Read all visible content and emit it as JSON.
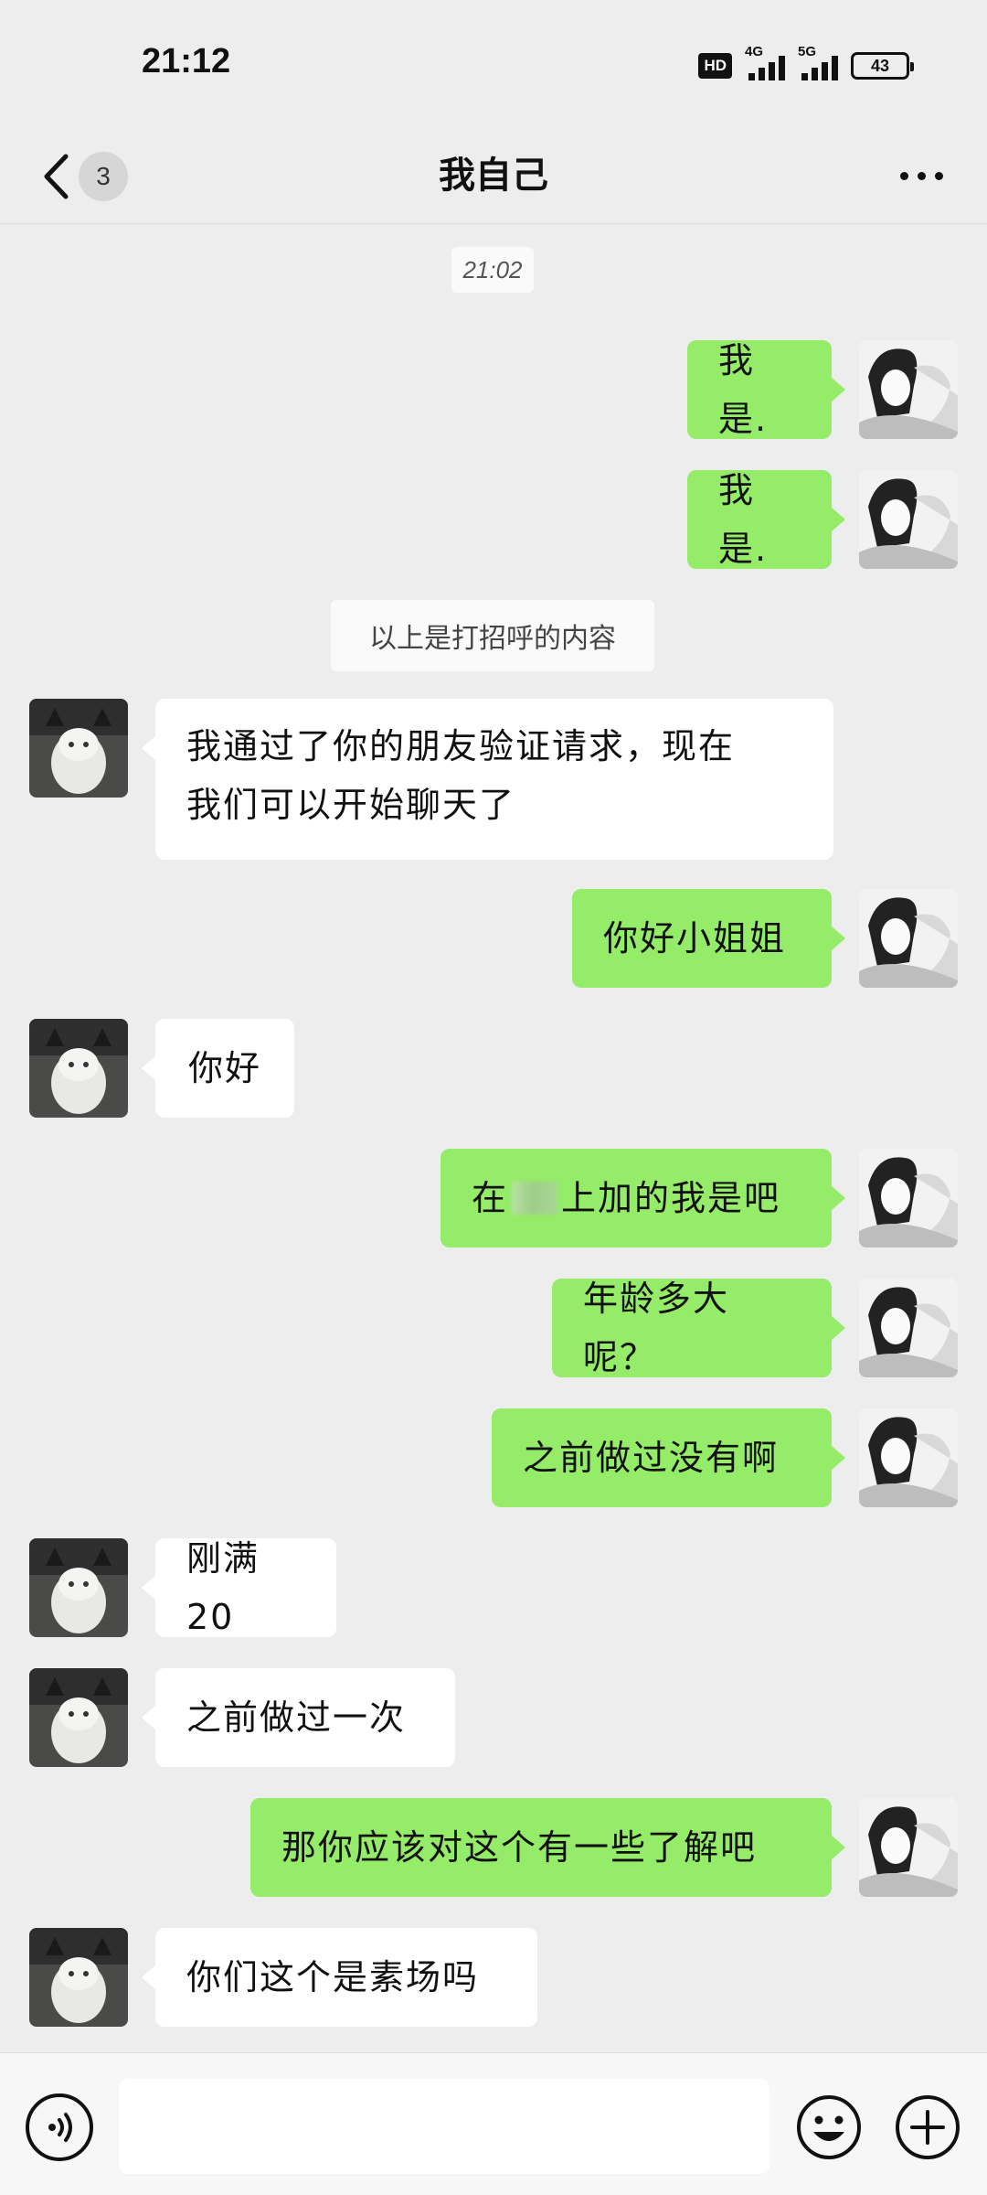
{
  "status_bar": {
    "time": "21:12",
    "hd": "HD",
    "network_1": "4G",
    "network_2": "5G",
    "battery": "43"
  },
  "header": {
    "unread_count": "3",
    "title": "我自己"
  },
  "messages": {
    "timestamp": "21:02",
    "m1": "我是.",
    "m2": "我是.",
    "system_note": "以上是打招呼的内容",
    "m3_line1": "我通过了你的朋友验证请求，现在",
    "m3_line2": "我们可以开始聊天了",
    "m4": "你好小姐姐",
    "m5": "你好",
    "m6_before": "在",
    "m6_after": "上加的我是吧",
    "m7": "年龄多大呢？",
    "m8": "之前做过没有啊",
    "m9": "刚满20",
    "m10": "之前做过一次",
    "m11": "那你应该对这个有一些了解吧",
    "m12": "你们这个是素场吗"
  },
  "input": {
    "value": "",
    "placeholder": ""
  },
  "icons": {
    "back": "chevron-left-icon",
    "more": "more-dots-icon",
    "voice": "voice-icon",
    "emoji": "emoji-icon",
    "plus": "plus-icon"
  },
  "colors": {
    "background": "#ededed",
    "sent_bubble": "#95ec69",
    "received_bubble": "#ffffff"
  }
}
